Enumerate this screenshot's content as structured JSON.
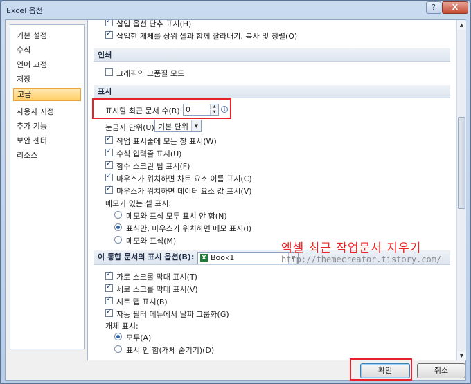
{
  "window": {
    "title": "Excel 옵션",
    "help_label": "?",
    "close_label": "X"
  },
  "sidebar": {
    "items": [
      {
        "label": "기본 설정"
      },
      {
        "label": "수식"
      },
      {
        "label": "언어 교정"
      },
      {
        "label": "저장"
      },
      {
        "label": "고급",
        "selected": true
      },
      {
        "label": "사용자 지정"
      },
      {
        "label": "추가 기능"
      },
      {
        "label": "보안 센터"
      },
      {
        "label": "리소스"
      }
    ]
  },
  "top_partial": {
    "option1": "삽입 옵션 단추 표시(H)",
    "option2": "삽입한 개체를 상위 셀과 함께 잘라내기, 복사 및 정렬(O)"
  },
  "print_section": {
    "title": "인쇄",
    "option1": "그래픽의 고품질 모드"
  },
  "display_section": {
    "title": "표시",
    "recent_docs_label": "표시할 최근 문서 수(R):",
    "recent_docs_value": "0",
    "ruler_units_label": "눈금자 단위(U)",
    "ruler_units_value": "기본 단위",
    "checkboxes": [
      "작업 표시줄에 모든 창 표시(W)",
      "수식 입력줄 표시(U)",
      "함수 스크린 팁 표시(F)",
      "마우스가 위치하면 차트 요소 이름 표시(C)",
      "마우스가 위치하면 데이터 요소 값 표시(V)"
    ],
    "comments_label": "메모가 있는 셀 표시:",
    "radios": [
      "메모와 표식 모두 표시 안 함(N)",
      "표식만, 마우스가 위치하면 메모 표시(I)",
      "메모와 표식(M)"
    ]
  },
  "workbook_section": {
    "title": "이 통합 문서의 표시 옵션(B):",
    "workbook_value": "Book1",
    "excel_icon_letter": "X",
    "checkboxes": [
      "가로 스크롤 막대 표시(T)",
      "세로 스크롤 막대 표시(V)",
      "시트 탭 표시(B)",
      "자동 필터 메뉴에서 날짜 그룹화(G)"
    ],
    "objects_label": "개체 표시:",
    "radios": [
      "모두(A)",
      "표시 안 함(개체 숨기기)(D)"
    ]
  },
  "watermark": {
    "title": "엑셀 최근 작업문서 지우기",
    "url": "http://themecreator.tistory.com/"
  },
  "buttons": {
    "ok": "확인",
    "cancel": "취소"
  },
  "icons": {
    "info": "i",
    "spin_up": "▲",
    "spin_down": "▼",
    "dropdown": "▼",
    "scroll_up": "▲",
    "scroll_down": "▼"
  },
  "colors": {
    "highlight": "#e8222c",
    "selected_nav": "#ffcf66"
  }
}
